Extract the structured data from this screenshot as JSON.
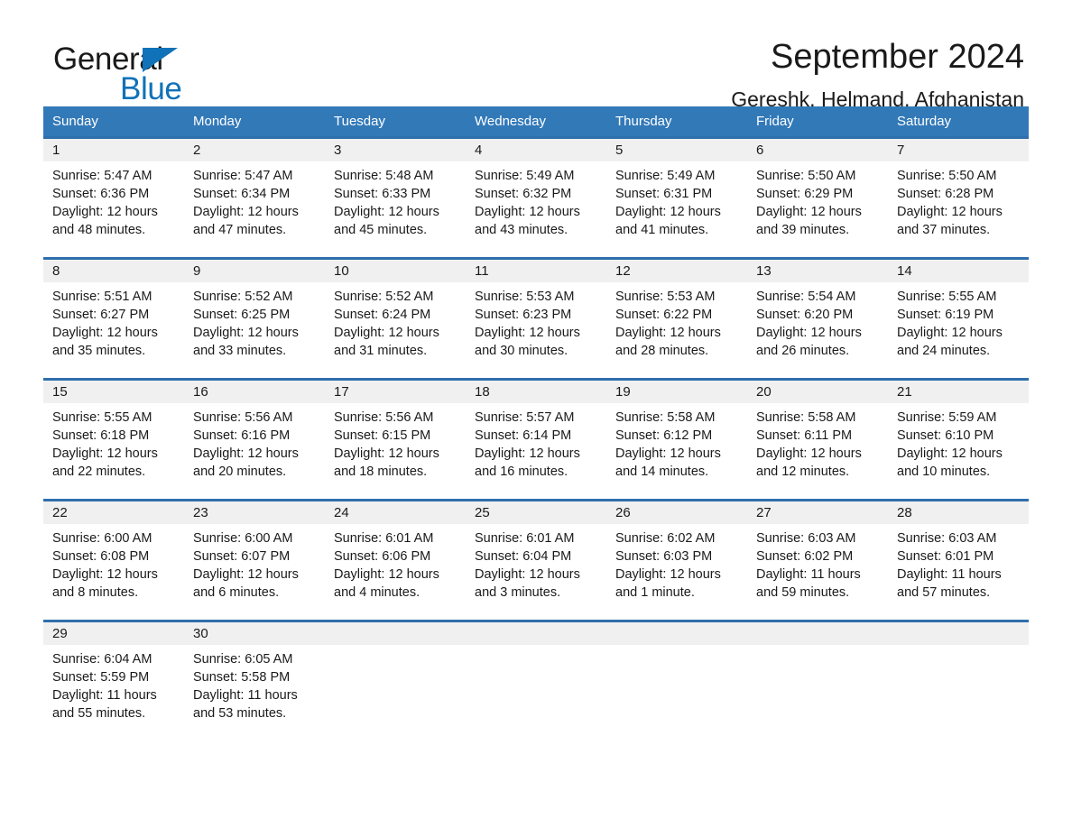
{
  "brand": {
    "name_part1": "General",
    "name_part2": "Blue",
    "accent_color": "#1072b8"
  },
  "header": {
    "title": "September 2024",
    "subtitle": "Gereshk, Helmand, Afghanistan"
  },
  "theme": {
    "header_blue": "#3279b8",
    "rule_blue": "#2f6fad",
    "date_band_gray": "#f0f0f0"
  },
  "weekdays": [
    "Sunday",
    "Monday",
    "Tuesday",
    "Wednesday",
    "Thursday",
    "Friday",
    "Saturday"
  ],
  "weeks": [
    [
      {
        "day": "1",
        "sunrise": "Sunrise: 5:47 AM",
        "sunset": "Sunset: 6:36 PM",
        "daylight1": "Daylight: 12 hours",
        "daylight2": "and 48 minutes."
      },
      {
        "day": "2",
        "sunrise": "Sunrise: 5:47 AM",
        "sunset": "Sunset: 6:34 PM",
        "daylight1": "Daylight: 12 hours",
        "daylight2": "and 47 minutes."
      },
      {
        "day": "3",
        "sunrise": "Sunrise: 5:48 AM",
        "sunset": "Sunset: 6:33 PM",
        "daylight1": "Daylight: 12 hours",
        "daylight2": "and 45 minutes."
      },
      {
        "day": "4",
        "sunrise": "Sunrise: 5:49 AM",
        "sunset": "Sunset: 6:32 PM",
        "daylight1": "Daylight: 12 hours",
        "daylight2": "and 43 minutes."
      },
      {
        "day": "5",
        "sunrise": "Sunrise: 5:49 AM",
        "sunset": "Sunset: 6:31 PM",
        "daylight1": "Daylight: 12 hours",
        "daylight2": "and 41 minutes."
      },
      {
        "day": "6",
        "sunrise": "Sunrise: 5:50 AM",
        "sunset": "Sunset: 6:29 PM",
        "daylight1": "Daylight: 12 hours",
        "daylight2": "and 39 minutes."
      },
      {
        "day": "7",
        "sunrise": "Sunrise: 5:50 AM",
        "sunset": "Sunset: 6:28 PM",
        "daylight1": "Daylight: 12 hours",
        "daylight2": "and 37 minutes."
      }
    ],
    [
      {
        "day": "8",
        "sunrise": "Sunrise: 5:51 AM",
        "sunset": "Sunset: 6:27 PM",
        "daylight1": "Daylight: 12 hours",
        "daylight2": "and 35 minutes."
      },
      {
        "day": "9",
        "sunrise": "Sunrise: 5:52 AM",
        "sunset": "Sunset: 6:25 PM",
        "daylight1": "Daylight: 12 hours",
        "daylight2": "and 33 minutes."
      },
      {
        "day": "10",
        "sunrise": "Sunrise: 5:52 AM",
        "sunset": "Sunset: 6:24 PM",
        "daylight1": "Daylight: 12 hours",
        "daylight2": "and 31 minutes."
      },
      {
        "day": "11",
        "sunrise": "Sunrise: 5:53 AM",
        "sunset": "Sunset: 6:23 PM",
        "daylight1": "Daylight: 12 hours",
        "daylight2": "and 30 minutes."
      },
      {
        "day": "12",
        "sunrise": "Sunrise: 5:53 AM",
        "sunset": "Sunset: 6:22 PM",
        "daylight1": "Daylight: 12 hours",
        "daylight2": "and 28 minutes."
      },
      {
        "day": "13",
        "sunrise": "Sunrise: 5:54 AM",
        "sunset": "Sunset: 6:20 PM",
        "daylight1": "Daylight: 12 hours",
        "daylight2": "and 26 minutes."
      },
      {
        "day": "14",
        "sunrise": "Sunrise: 5:55 AM",
        "sunset": "Sunset: 6:19 PM",
        "daylight1": "Daylight: 12 hours",
        "daylight2": "and 24 minutes."
      }
    ],
    [
      {
        "day": "15",
        "sunrise": "Sunrise: 5:55 AM",
        "sunset": "Sunset: 6:18 PM",
        "daylight1": "Daylight: 12 hours",
        "daylight2": "and 22 minutes."
      },
      {
        "day": "16",
        "sunrise": "Sunrise: 5:56 AM",
        "sunset": "Sunset: 6:16 PM",
        "daylight1": "Daylight: 12 hours",
        "daylight2": "and 20 minutes."
      },
      {
        "day": "17",
        "sunrise": "Sunrise: 5:56 AM",
        "sunset": "Sunset: 6:15 PM",
        "daylight1": "Daylight: 12 hours",
        "daylight2": "and 18 minutes."
      },
      {
        "day": "18",
        "sunrise": "Sunrise: 5:57 AM",
        "sunset": "Sunset: 6:14 PM",
        "daylight1": "Daylight: 12 hours",
        "daylight2": "and 16 minutes."
      },
      {
        "day": "19",
        "sunrise": "Sunrise: 5:58 AM",
        "sunset": "Sunset: 6:12 PM",
        "daylight1": "Daylight: 12 hours",
        "daylight2": "and 14 minutes."
      },
      {
        "day": "20",
        "sunrise": "Sunrise: 5:58 AM",
        "sunset": "Sunset: 6:11 PM",
        "daylight1": "Daylight: 12 hours",
        "daylight2": "and 12 minutes."
      },
      {
        "day": "21",
        "sunrise": "Sunrise: 5:59 AM",
        "sunset": "Sunset: 6:10 PM",
        "daylight1": "Daylight: 12 hours",
        "daylight2": "and 10 minutes."
      }
    ],
    [
      {
        "day": "22",
        "sunrise": "Sunrise: 6:00 AM",
        "sunset": "Sunset: 6:08 PM",
        "daylight1": "Daylight: 12 hours",
        "daylight2": "and 8 minutes."
      },
      {
        "day": "23",
        "sunrise": "Sunrise: 6:00 AM",
        "sunset": "Sunset: 6:07 PM",
        "daylight1": "Daylight: 12 hours",
        "daylight2": "and 6 minutes."
      },
      {
        "day": "24",
        "sunrise": "Sunrise: 6:01 AM",
        "sunset": "Sunset: 6:06 PM",
        "daylight1": "Daylight: 12 hours",
        "daylight2": "and 4 minutes."
      },
      {
        "day": "25",
        "sunrise": "Sunrise: 6:01 AM",
        "sunset": "Sunset: 6:04 PM",
        "daylight1": "Daylight: 12 hours",
        "daylight2": "and 3 minutes."
      },
      {
        "day": "26",
        "sunrise": "Sunrise: 6:02 AM",
        "sunset": "Sunset: 6:03 PM",
        "daylight1": "Daylight: 12 hours",
        "daylight2": "and 1 minute."
      },
      {
        "day": "27",
        "sunrise": "Sunrise: 6:03 AM",
        "sunset": "Sunset: 6:02 PM",
        "daylight1": "Daylight: 11 hours",
        "daylight2": "and 59 minutes."
      },
      {
        "day": "28",
        "sunrise": "Sunrise: 6:03 AM",
        "sunset": "Sunset: 6:01 PM",
        "daylight1": "Daylight: 11 hours",
        "daylight2": "and 57 minutes."
      }
    ],
    [
      {
        "day": "29",
        "sunrise": "Sunrise: 6:04 AM",
        "sunset": "Sunset: 5:59 PM",
        "daylight1": "Daylight: 11 hours",
        "daylight2": "and 55 minutes."
      },
      {
        "day": "30",
        "sunrise": "Sunrise: 6:05 AM",
        "sunset": "Sunset: 5:58 PM",
        "daylight1": "Daylight: 11 hours",
        "daylight2": "and 53 minutes."
      },
      {
        "day": "",
        "sunrise": "",
        "sunset": "",
        "daylight1": "",
        "daylight2": ""
      },
      {
        "day": "",
        "sunrise": "",
        "sunset": "",
        "daylight1": "",
        "daylight2": ""
      },
      {
        "day": "",
        "sunrise": "",
        "sunset": "",
        "daylight1": "",
        "daylight2": ""
      },
      {
        "day": "",
        "sunrise": "",
        "sunset": "",
        "daylight1": "",
        "daylight2": ""
      },
      {
        "day": "",
        "sunrise": "",
        "sunset": "",
        "daylight1": "",
        "daylight2": ""
      }
    ]
  ]
}
